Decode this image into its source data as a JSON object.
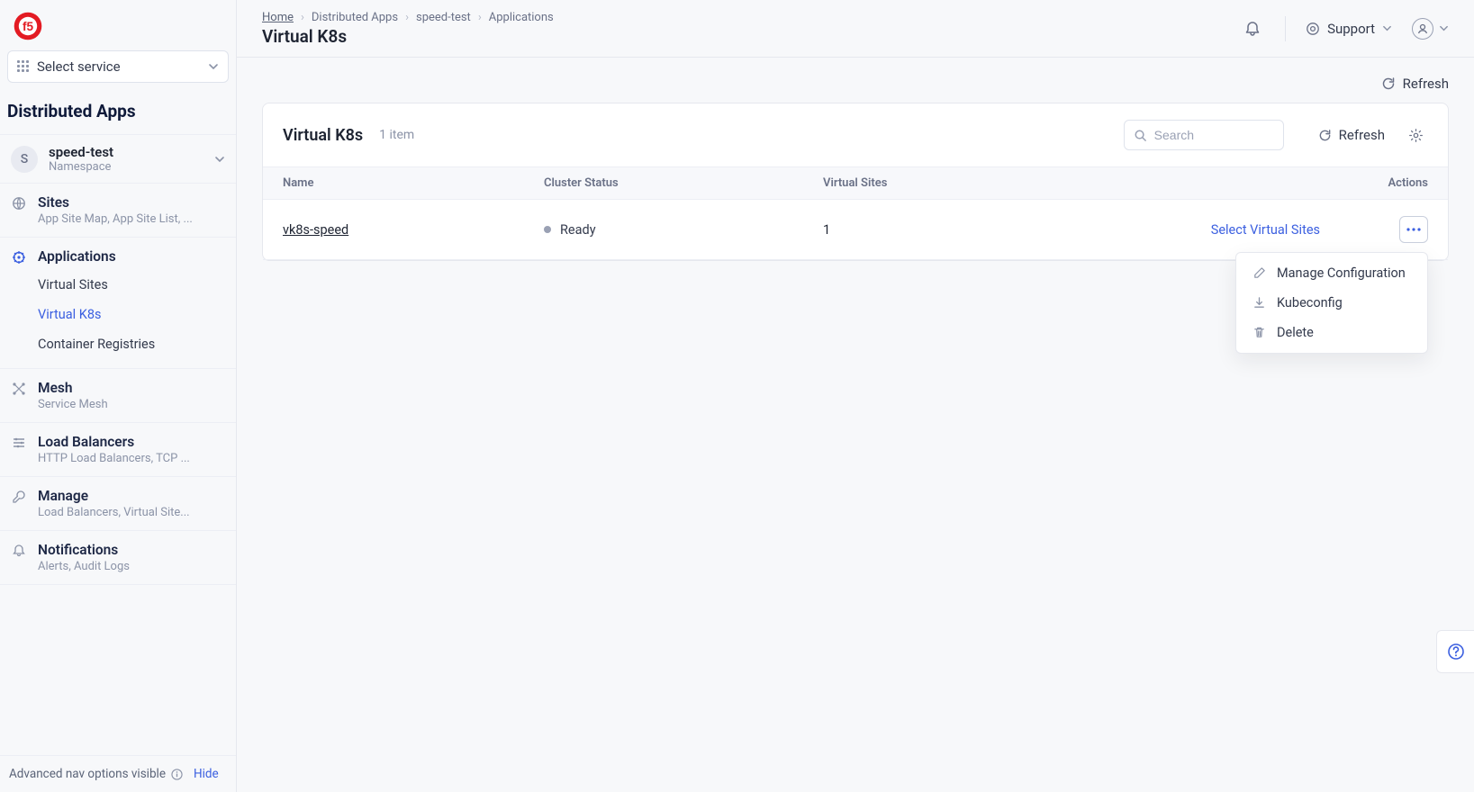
{
  "breadcrumbs": [
    "Home",
    "Distributed Apps",
    "speed-test",
    "Applications"
  ],
  "page_title": "Virtual K8s",
  "header": {
    "support_label": "Support"
  },
  "sidebar": {
    "service_select_label": "Select service",
    "section_title": "Distributed Apps",
    "namespace": {
      "initial": "S",
      "name": "speed-test",
      "subtitle": "Namespace"
    },
    "items": [
      {
        "label": "Sites",
        "sub": "App Site Map, App Site List, ..."
      },
      {
        "label": "Applications",
        "sub": ""
      },
      {
        "label": "Mesh",
        "sub": "Service Mesh"
      },
      {
        "label": "Load Balancers",
        "sub": "HTTP Load Balancers, TCP ..."
      },
      {
        "label": "Manage",
        "sub": "Load Balancers, Virtual Site..."
      },
      {
        "label": "Notifications",
        "sub": "Alerts, Audit Logs"
      }
    ],
    "applications_sub": [
      "Virtual Sites",
      "Virtual K8s",
      "Container Registries"
    ],
    "footer_text": "Advanced nav options visible",
    "footer_hide": "Hide"
  },
  "content": {
    "refresh_label": "Refresh",
    "card_title": "Virtual K8s",
    "item_count": "1 item",
    "search_placeholder": "Search",
    "card_refresh": "Refresh",
    "columns": {
      "name": "Name",
      "status": "Cluster Status",
      "vsites": "Virtual Sites",
      "actions": "Actions"
    },
    "rows": [
      {
        "name": "vk8s-speed",
        "status": "Ready",
        "vsites": "1",
        "select_label": "Select Virtual Sites"
      }
    ],
    "dropdown": {
      "manage": "Manage Configuration",
      "kubeconfig": "Kubeconfig",
      "delete": "Delete"
    }
  }
}
